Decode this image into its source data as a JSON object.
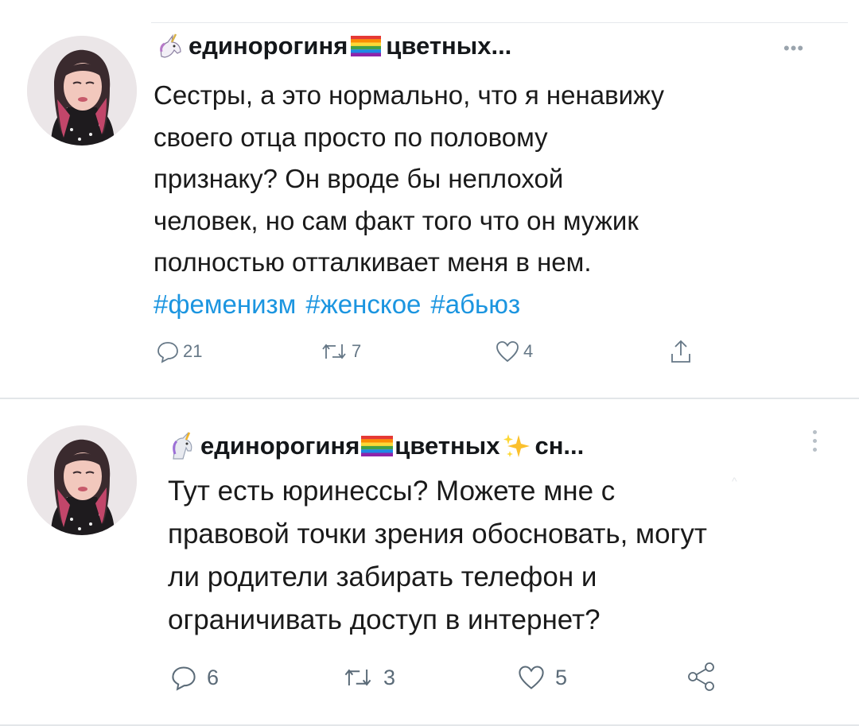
{
  "tweets": [
    {
      "author_name": "единорогиня",
      "author_name_suffix": "цветных...",
      "text_lines": [
        "Сестры, а это нормально, что я ненавижу",
        "своего отца просто по половому",
        "признаку? Он вроде бы неплохой",
        "человек, но сам факт того что он мужик",
        "полностью отталкивает меня в нем."
      ],
      "hashtags": [
        "#феменизм",
        "#женское",
        "#абьюз"
      ],
      "replies": "21",
      "retweets": "7",
      "likes": "4",
      "icons": [
        "unicorn-icon",
        "rainbow-flag-icon",
        "reply-icon",
        "retweet-icon",
        "like-icon",
        "share-icon",
        "more-icon"
      ]
    },
    {
      "author_name": "единорогиня",
      "author_name_mid": "цветных",
      "author_name_suffix": "сн...",
      "text_lines": [
        "Тут есть юринессы? Можете мне с",
        "правовой точки зрения обосновать, могут",
        "ли родители забирать телефон и",
        "ограничивать доступ в интернет?"
      ],
      "replies": "6",
      "retweets": "3",
      "likes": "5",
      "icons": [
        "unicorn-icon",
        "rainbow-flag-icon",
        "sparkles-icon",
        "reply-icon",
        "retweet-icon",
        "like-icon",
        "share-icon",
        "more-icon"
      ]
    }
  ],
  "colors": {
    "hashtag": "#1b95e0",
    "icon_gray": "#657786",
    "divider": "#e3e6e9"
  }
}
